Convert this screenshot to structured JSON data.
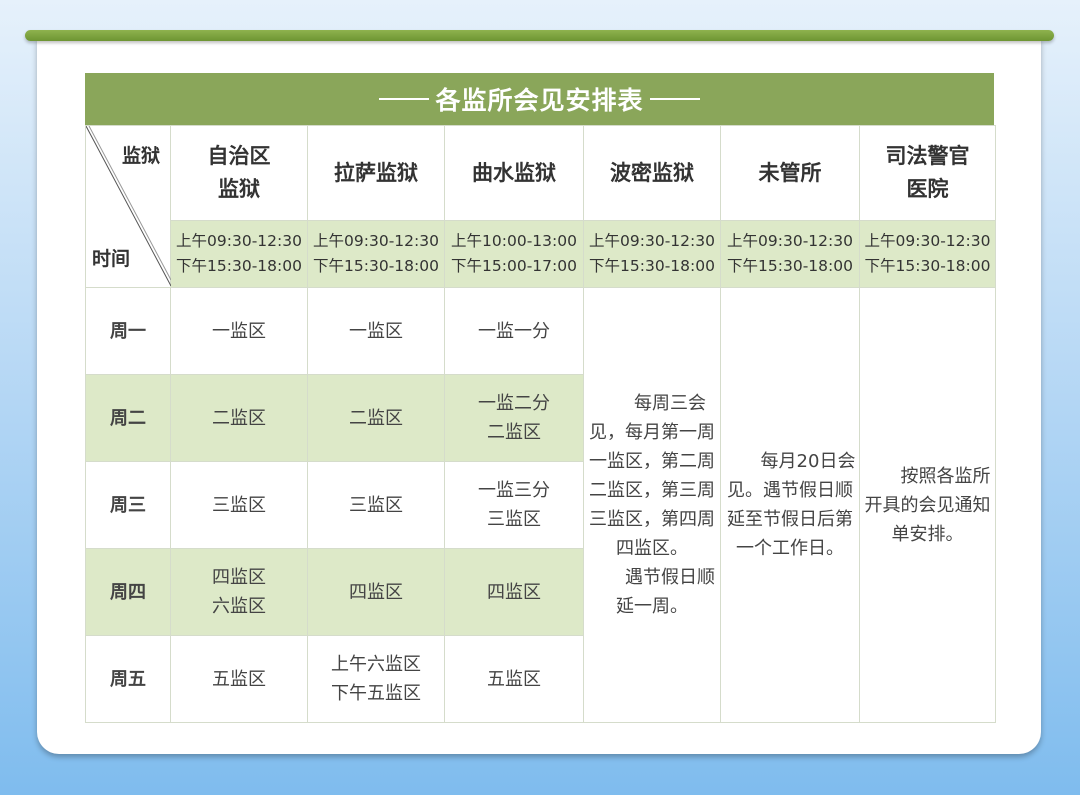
{
  "title": "各监所会见安排表",
  "corner": {
    "top": "监狱",
    "bottom": "时间"
  },
  "prisons": [
    {
      "name": [
        "自治区",
        "监狱"
      ],
      "time": [
        "上午09:30-12:30",
        "下午15:30-18:00"
      ]
    },
    {
      "name": [
        "拉萨监狱"
      ],
      "time": [
        "上午09:30-12:30",
        "下午15:30-18:00"
      ]
    },
    {
      "name": [
        "曲水监狱"
      ],
      "time": [
        "上午10:00-13:00",
        "下午15:00-17:00"
      ]
    },
    {
      "name": [
        "波密监狱"
      ],
      "time": [
        "上午09:30-12:30",
        "下午15:30-18:00"
      ]
    },
    {
      "name": [
        "未管所"
      ],
      "time": [
        "上午09:30-12:30",
        "下午15:30-18:00"
      ]
    },
    {
      "name": [
        "司法警官",
        "医院"
      ],
      "time": [
        "上午09:30-12:30",
        "下午15:30-18:00"
      ]
    }
  ],
  "rows": [
    {
      "day": "周一",
      "cells": [
        [
          "一监区"
        ],
        [
          "一监区"
        ],
        [
          "一监一分"
        ]
      ]
    },
    {
      "day": "周二",
      "cells": [
        [
          "二监区"
        ],
        [
          "二监区"
        ],
        [
          "一监二分",
          "二监区"
        ]
      ]
    },
    {
      "day": "周三",
      "cells": [
        [
          "三监区"
        ],
        [
          "三监区"
        ],
        [
          "一监三分",
          "三监区"
        ]
      ]
    },
    {
      "day": "周四",
      "cells": [
        [
          "四监区",
          "六监区"
        ],
        [
          "四监区"
        ],
        [
          "四监区"
        ]
      ]
    },
    {
      "day": "周五",
      "cells": [
        [
          "五监区"
        ],
        [
          "上午六监区",
          "下午五监区"
        ],
        [
          "五监区"
        ]
      ]
    }
  ],
  "notes": {
    "bomi": [
      "每周三会见，每月第一周一监区，第二周二监区，第三周三监区，第四周四监区。",
      "遇节假日顺延一周。"
    ],
    "weiguansuo": "每月20日会见。遇节假日顺延至节假日后第一个工作日。",
    "hospital": "按照各监所开具的会见通知单安排。"
  }
}
